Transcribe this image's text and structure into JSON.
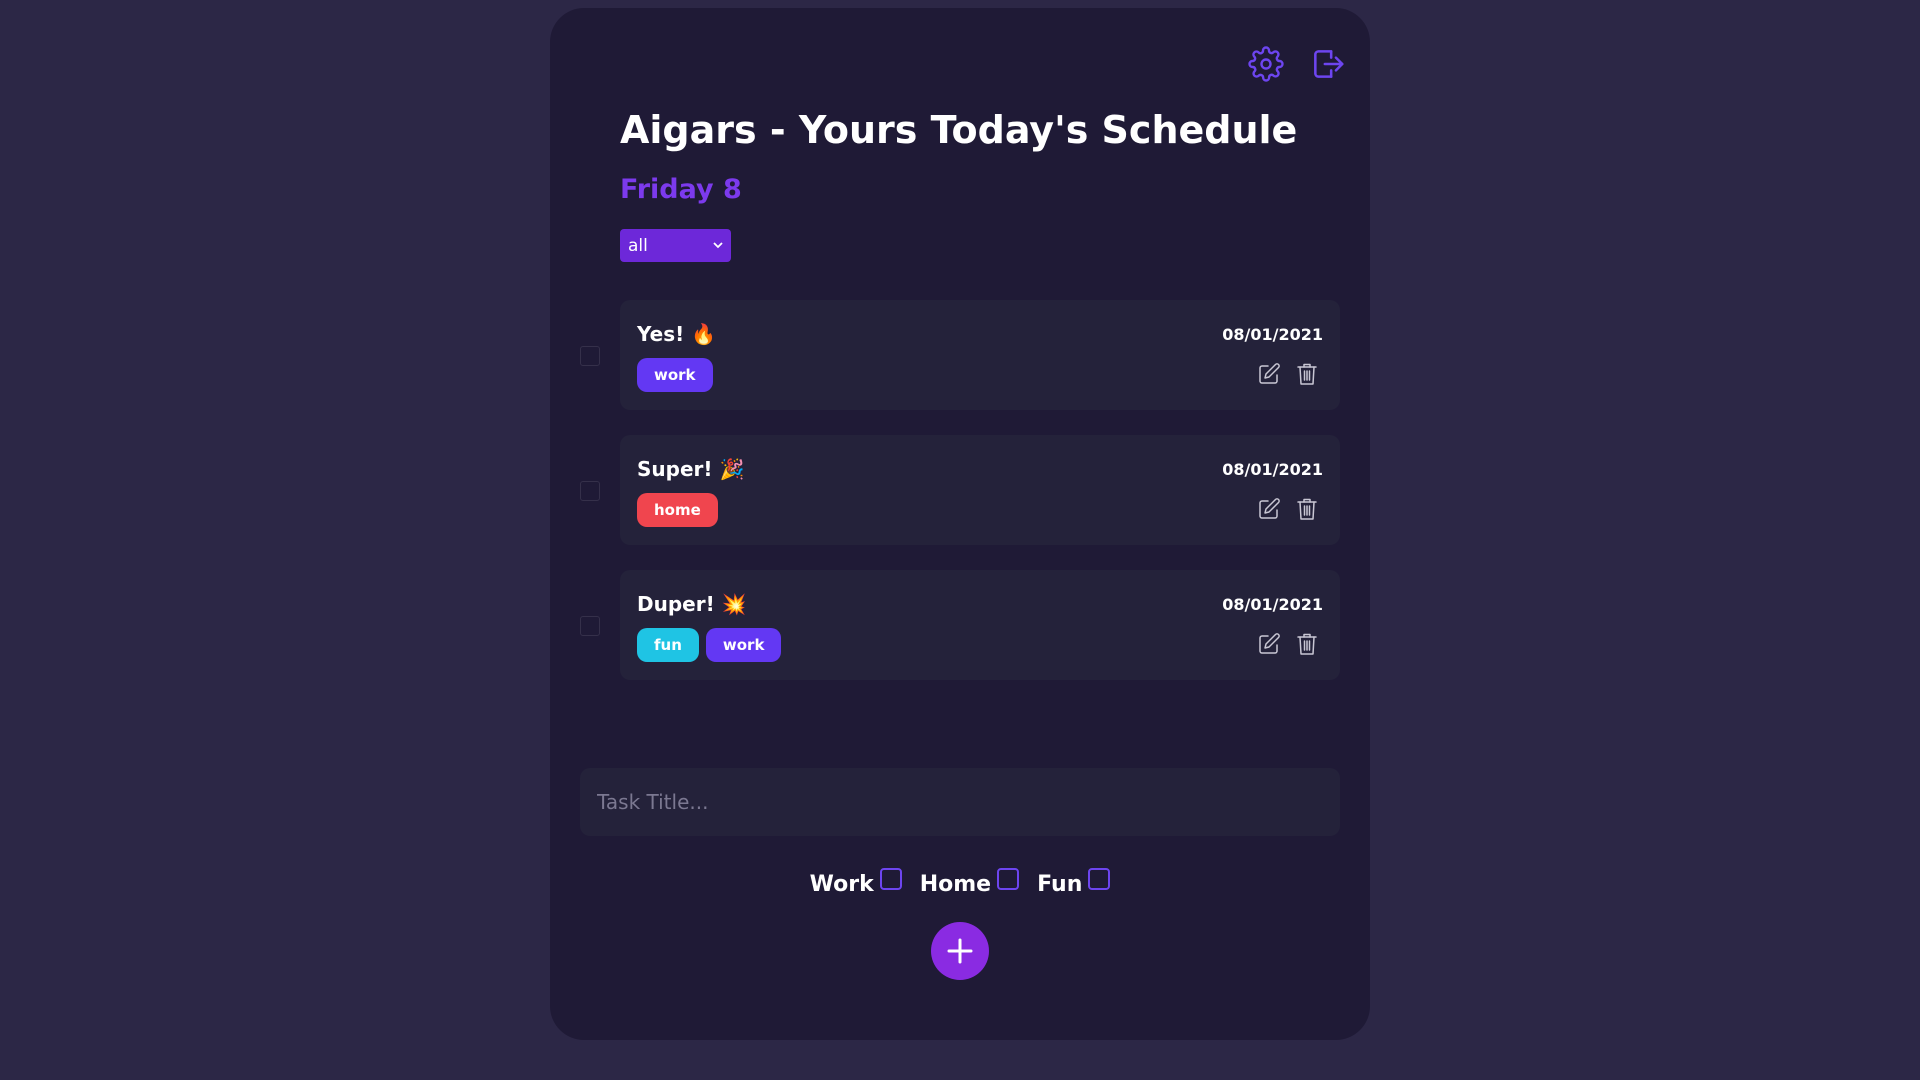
{
  "header": {
    "title": "Aigars - Yours Today's Schedule",
    "date": "Friday 8",
    "settings_icon": "gear-icon",
    "logout_icon": "sign-out-icon"
  },
  "filter": {
    "selected": "all",
    "options": [
      "all"
    ]
  },
  "tasks": [
    {
      "title": "Yes! 🔥",
      "date": "08/01/2021",
      "tags": [
        "work"
      ],
      "completed": false
    },
    {
      "title": "Super! 🎉",
      "date": "08/01/2021",
      "tags": [
        "home"
      ],
      "completed": false
    },
    {
      "title": "Duper! 💥",
      "date": "08/01/2021",
      "tags": [
        "fun",
        "work"
      ],
      "completed": false
    }
  ],
  "new_task": {
    "placeholder": "Task Title...",
    "value": ""
  },
  "categories": [
    {
      "label": "Work",
      "checked": false
    },
    {
      "label": "Home",
      "checked": false
    },
    {
      "label": "Fun",
      "checked": false
    }
  ],
  "colors": {
    "background": "#2c2746",
    "card": "#1f1a36",
    "task_card": "#24223a",
    "accent": "#7c3aed",
    "tag_work": "#6338f3",
    "tag_home": "#f0454e",
    "tag_fun": "#1fc4e4",
    "add_button": "#8a2be2"
  }
}
